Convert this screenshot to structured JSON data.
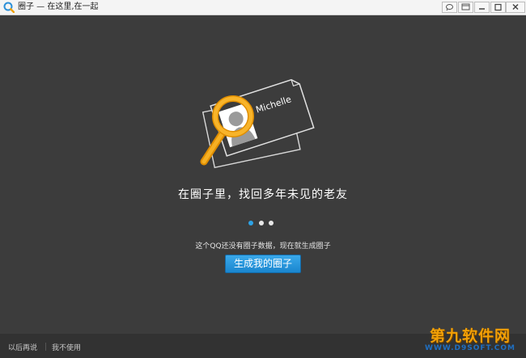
{
  "window": {
    "title": "圈子 — 在这里,在一起"
  },
  "hero": {
    "card_name": "Michelle",
    "headline": "在圈子里，找回多年未见的老友"
  },
  "pager": {
    "total": 3,
    "active_index": 0
  },
  "main": {
    "description": "这个QQ还没有圈子数据，现在就生成圈子",
    "cta_label": "生成我的圈子"
  },
  "footer": {
    "later_label": "以后再说",
    "never_label": "我不使用"
  },
  "watermark": {
    "brand": "第九软件网",
    "site": "WWW.D9SOFT.COM"
  },
  "colors": {
    "background": "#3c3c3c",
    "accent": "#2ea3e6",
    "magnifier": "#f0a20a"
  }
}
